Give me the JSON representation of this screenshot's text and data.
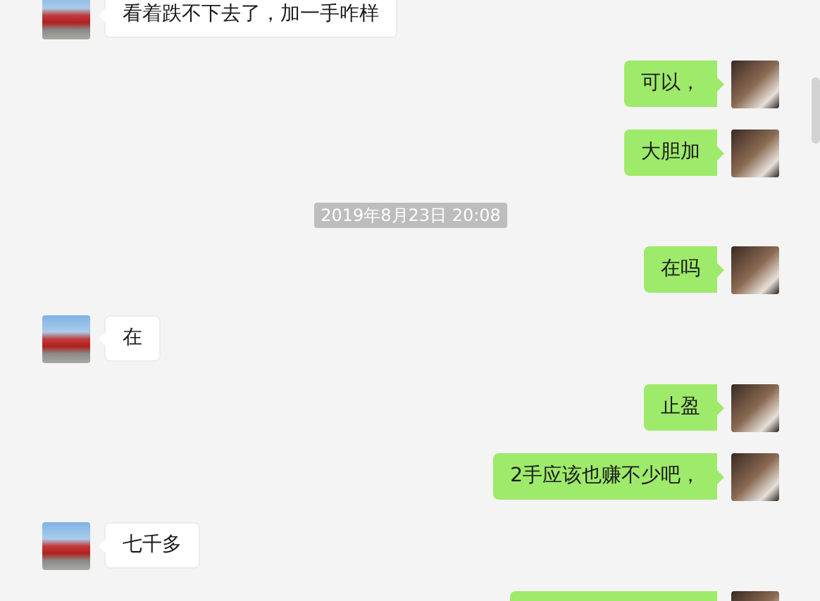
{
  "messages": [
    {
      "kind": "incoming",
      "text": "看着跌不下去了，加一手咋样"
    },
    {
      "kind": "outgoing",
      "text": "可以，"
    },
    {
      "kind": "outgoing",
      "text": "大胆加"
    },
    {
      "kind": "timestamp",
      "text": "2019年8月23日 20:08"
    },
    {
      "kind": "outgoing",
      "text": "在吗"
    },
    {
      "kind": "incoming",
      "text": "在"
    },
    {
      "kind": "outgoing",
      "text": "止盈"
    },
    {
      "kind": "outgoing",
      "text": "2手应该也赚不少吧，"
    },
    {
      "kind": "incoming",
      "text": "七千多"
    },
    {
      "kind": "outgoing"
    }
  ]
}
